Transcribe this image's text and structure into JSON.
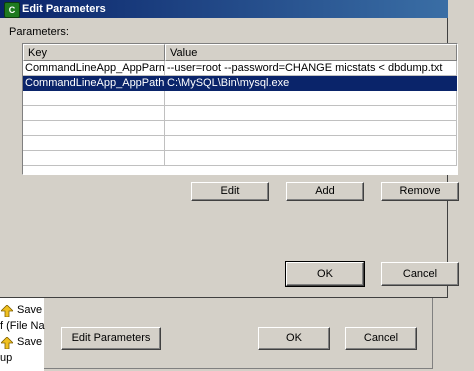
{
  "dialog": {
    "title": "Edit Parameters",
    "title_icon_glyph": "C",
    "parameters_label": "Parameters:",
    "table": {
      "headers": [
        "Key",
        "Value"
      ],
      "rows": [
        [
          "CommandLineApp_AppParms",
          "--user=root --password=CHANGE micstats < dbdump.txt"
        ],
        [
          "CommandLineApp_AppPath",
          "C:\\MySQL\\Bin\\mysql.exe"
        ]
      ],
      "selected_row": 1
    },
    "buttons": {
      "edit": "Edit",
      "add": "Add",
      "remove": "Remove",
      "ok": "OK",
      "cancel": "Cancel"
    }
  },
  "background": {
    "list_items": [
      {
        "icon": "save-icon",
        "text": "Save"
      },
      {
        "icon": "",
        "text": "f (File Na"
      },
      {
        "icon": "save-icon",
        "text": "Save"
      },
      {
        "icon": "",
        "text": "up"
      }
    ],
    "buttons": {
      "edit_parameters": "Edit Parameters",
      "ok": "OK",
      "cancel": "Cancel"
    }
  },
  "colors": {
    "titlebar_start": "#0a246a",
    "titlebar_end": "#3a6ea5",
    "selection": "#0a246a",
    "face": "#d4d0c8"
  }
}
